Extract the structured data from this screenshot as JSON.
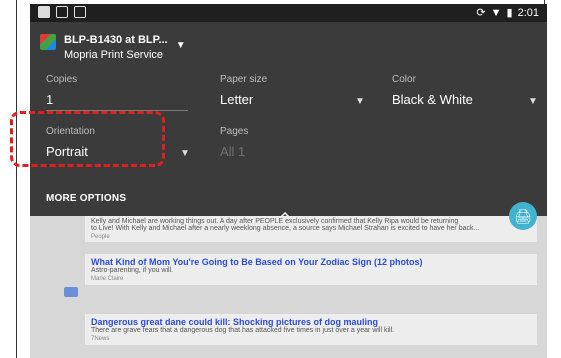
{
  "status_bar": {
    "time": "2:01"
  },
  "printer": {
    "name": "BLP-B1430 at BLP...",
    "service": "Mopria Print Service"
  },
  "settings": {
    "copies": {
      "label": "Copies",
      "value": "1"
    },
    "paper_size": {
      "label": "Paper size",
      "value": "Letter"
    },
    "color": {
      "label": "Color",
      "value": "Black & White"
    },
    "orientation": {
      "label": "Orientation",
      "value": "Portrait"
    },
    "pages": {
      "label": "Pages",
      "value": "All 1"
    }
  },
  "more_options": "MORE OPTIONS",
  "background": {
    "items": [
      {
        "line1": "Kelly and Michael are working things out. A day after PEOPLE exclusively confirmed that Kelly Ripa would be returning",
        "line2": "to Live! With Kelly and Michael after a nearly weeklong absence, a source says Michael Strahan is excited to have her back...",
        "meta": "People"
      },
      {
        "title": "What Kind of Mom You're Going to Be Based on Your Zodiac Sign (12 photos)",
        "subtitle": "Astro-parenting, if you will.",
        "meta": "Marie Claire"
      },
      {
        "title": "Dangerous great dane could kill: Shocking pictures of dog mauling",
        "subtitle": "There are grave fears that a dangerous dog that has attacked five times in just over a year will kill.",
        "meta": "7News"
      }
    ]
  },
  "accent_colors": {
    "fab": "#42b3cc",
    "highlight": "#e02020"
  }
}
